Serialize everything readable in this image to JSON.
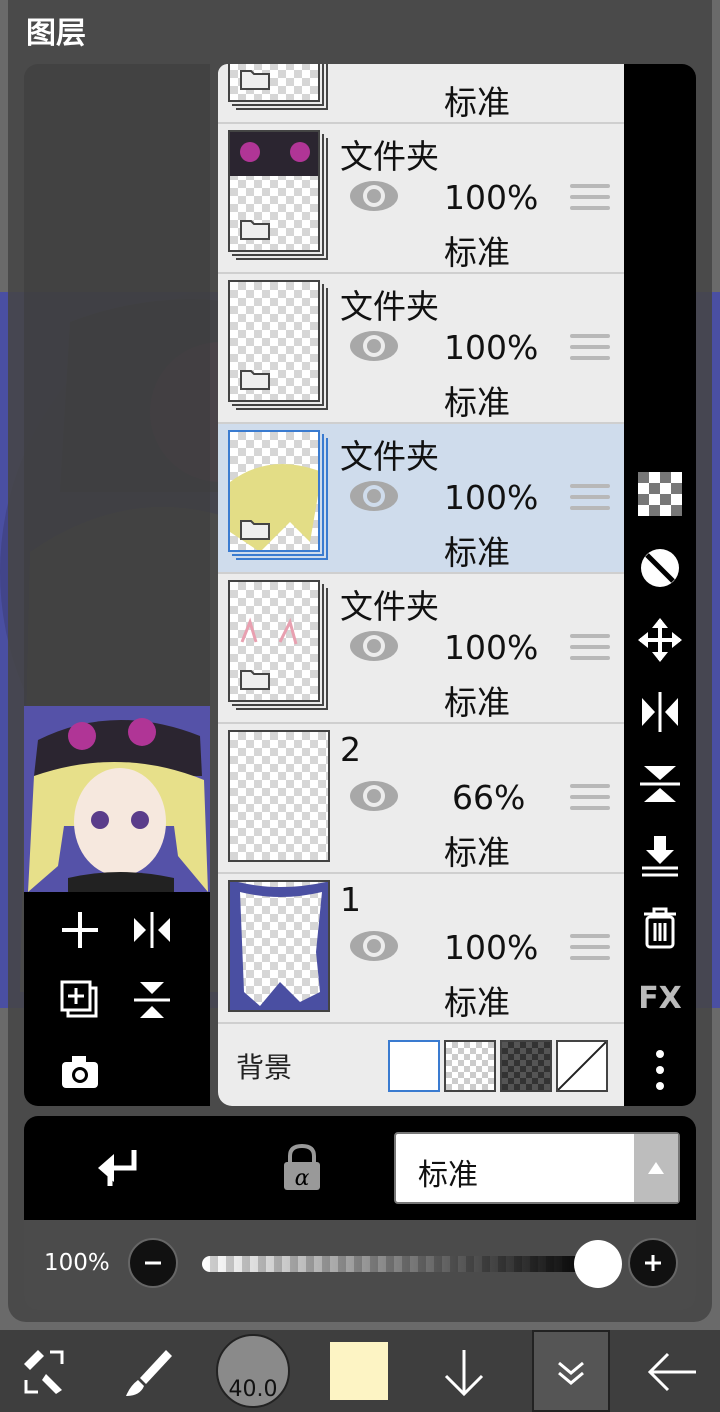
{
  "window": {
    "title": "图层"
  },
  "layers": [
    {
      "name": "",
      "opacity": "",
      "blend": "标准",
      "type": "folder",
      "selected": false
    },
    {
      "name": "文件夹",
      "opacity": "100%",
      "blend": "标准",
      "type": "folder",
      "selected": false
    },
    {
      "name": "文件夹",
      "opacity": "100%",
      "blend": "标准",
      "type": "folder",
      "selected": false
    },
    {
      "name": "文件夹",
      "opacity": "100%",
      "blend": "标准",
      "type": "folder",
      "selected": true
    },
    {
      "name": "文件夹",
      "opacity": "100%",
      "blend": "标准",
      "type": "folder",
      "selected": false
    },
    {
      "name": "2",
      "opacity": "66%",
      "blend": "标准",
      "type": "layer",
      "selected": false
    },
    {
      "name": "1",
      "opacity": "100%",
      "blend": "标准",
      "type": "layer",
      "selected": false
    }
  ],
  "background_row": {
    "label": "背景"
  },
  "blend_mode": {
    "value": "标准"
  },
  "opacity": {
    "value": "100%",
    "level": 1.0
  },
  "brush": {
    "size": "40.0"
  },
  "colors": {
    "current": "#fdf4c4",
    "selection": "#cfdcec",
    "accent": "#3a7bd0",
    "canvas": "#4a4fa2"
  },
  "side_toolbar": {
    "fx_label": "FX"
  },
  "icons": [
    "checker-icon",
    "half-circle-icon",
    "move-icon",
    "flip-horizontal-icon",
    "flip-vertical-icon",
    "merge-down-icon",
    "trash-icon",
    "more-icon",
    "add-layer-icon",
    "copy-layer-icon",
    "camera-icon",
    "clip-icon",
    "alpha-lock-icon",
    "transform-icon",
    "brush-icon",
    "arrow-down-icon",
    "back-arrow-icon"
  ]
}
